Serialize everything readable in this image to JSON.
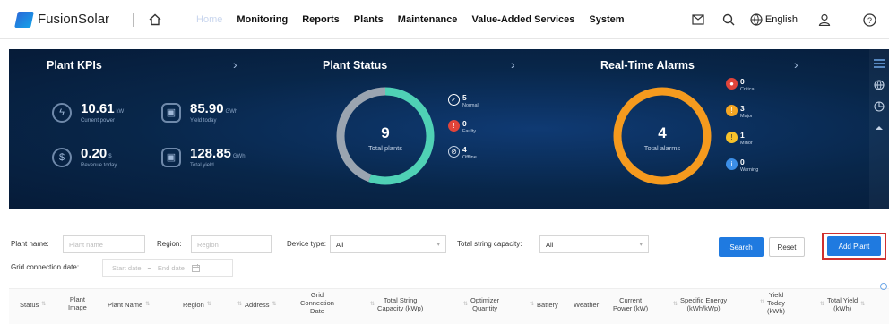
{
  "topbar": {
    "app_name": "FusionSolar",
    "nav": [
      "Home",
      "Monitoring",
      "Reports",
      "Plants",
      "Maintenance",
      "Value-Added Services",
      "System"
    ],
    "language": "English"
  },
  "kpis": {
    "title": "Plant KPIs",
    "current_power": {
      "value": "10.61",
      "unit": "kW",
      "label": "Current power"
    },
    "yield_today": {
      "value": "85.90",
      "unit": "GWh",
      "label": "Yield today"
    },
    "revenue_today": {
      "value": "0.20",
      "unit": "$",
      "label": "Revenue today"
    },
    "total_yield": {
      "value": "128.85",
      "unit": "GWh",
      "label": "Total yield"
    }
  },
  "plant_status": {
    "title": "Plant Status",
    "total": "9",
    "total_label": "Total plants",
    "normal": {
      "count": "5",
      "label": "Normal"
    },
    "faulty": {
      "count": "0",
      "label": "Faulty"
    },
    "offline": {
      "count": "4",
      "label": "Offline"
    },
    "colors": {
      "normal": "#4fd1b5",
      "faulty": "#e0443a",
      "offline": "#9aa4b0"
    }
  },
  "alarms": {
    "title": "Real-Time Alarms",
    "total": "4",
    "total_label": "Total alarms",
    "critical": {
      "count": "0",
      "label": "Critical"
    },
    "major": {
      "count": "3",
      "label": "Major"
    },
    "minor": {
      "count": "1",
      "label": "Minor"
    },
    "warning": {
      "count": "0",
      "label": "Warning"
    },
    "colors": {
      "critical": "#e0443a",
      "major": "#f5a623",
      "minor": "#f7c22b",
      "warning": "#3c8ee6",
      "ring": "#f59a1e"
    }
  },
  "filters": {
    "plant_name_label": "Plant name:",
    "plant_name_placeholder": "Plant name",
    "region_label": "Region:",
    "region_placeholder": "Region",
    "device_type_label": "Device type:",
    "device_type_value": "All",
    "capacity_label": "Total string capacity:",
    "capacity_value": "All",
    "grid_date_label": "Grid connection date:",
    "start_placeholder": "Start date",
    "end_placeholder": "End date",
    "date_sep": "~",
    "search": "Search",
    "reset": "Reset",
    "add_plant": "Add Plant"
  },
  "table": {
    "columns": [
      "Status",
      "Plant\nImage",
      "Plant Name",
      "Region",
      "Address",
      "Grid\nConnection\nDate",
      "Total String\nCapacity (kWp)",
      "Optimizer\nQuantity",
      "Battery",
      "Weather",
      "Current\nPower (kW)",
      "Specific Energy\n(kWh/kWp)",
      "Yield\nToday\n(kWh)",
      "Total Yield\n(kWh)"
    ]
  }
}
